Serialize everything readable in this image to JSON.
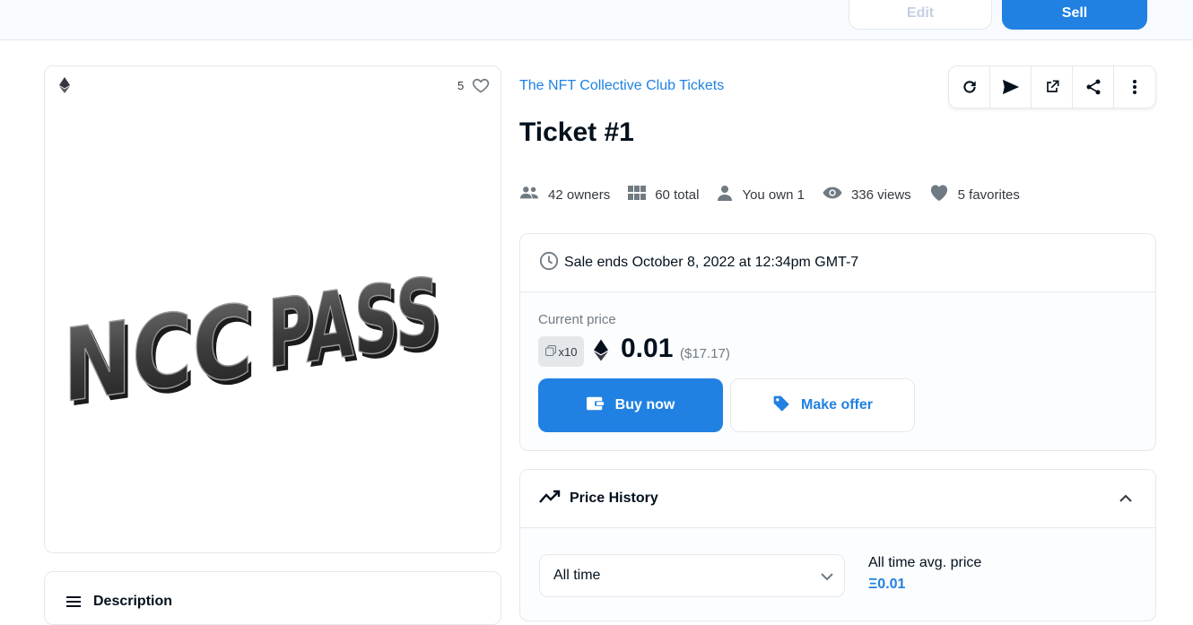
{
  "header": {
    "edit_label": "Edit",
    "sell_label": "Sell"
  },
  "asset": {
    "favorites_count": "5",
    "art_text": "NCC PASS",
    "collection": "The NFT Collective Club Tickets",
    "title": "Ticket #1"
  },
  "stats": {
    "owners": "42 owners",
    "total": "60 total",
    "you_own": "You own 1",
    "views": "336 views",
    "favorites": "5 favorites"
  },
  "sale": {
    "ends_text": "Sale ends October 8, 2022 at 12:34pm GMT-7",
    "current_price_label": "Current price",
    "quantity": "x10",
    "price": "0.01",
    "price_usd": "($17.17)",
    "buy_label": "Buy now",
    "offer_label": "Make offer"
  },
  "price_history": {
    "title": "Price History",
    "period": "All time",
    "avg_label": "All time avg. price",
    "avg_value": "Ξ0.01"
  },
  "description": {
    "title": "Description"
  },
  "colors": {
    "accent": "#2081e2",
    "text": "#04111d",
    "muted": "#707a83",
    "border": "#e5e8eb"
  },
  "icons": [
    "ethereum-icon",
    "heart-outline-icon",
    "refresh-icon",
    "send-icon",
    "external-link-icon",
    "share-icon",
    "more-vertical-icon",
    "people-icon",
    "grid-icon",
    "person-icon",
    "eye-icon",
    "heart-icon",
    "clock-icon",
    "copies-icon",
    "wallet-icon",
    "tag-icon",
    "trending-icon",
    "chevron-up-icon",
    "chevron-down-icon",
    "menu-lines-icon"
  ]
}
